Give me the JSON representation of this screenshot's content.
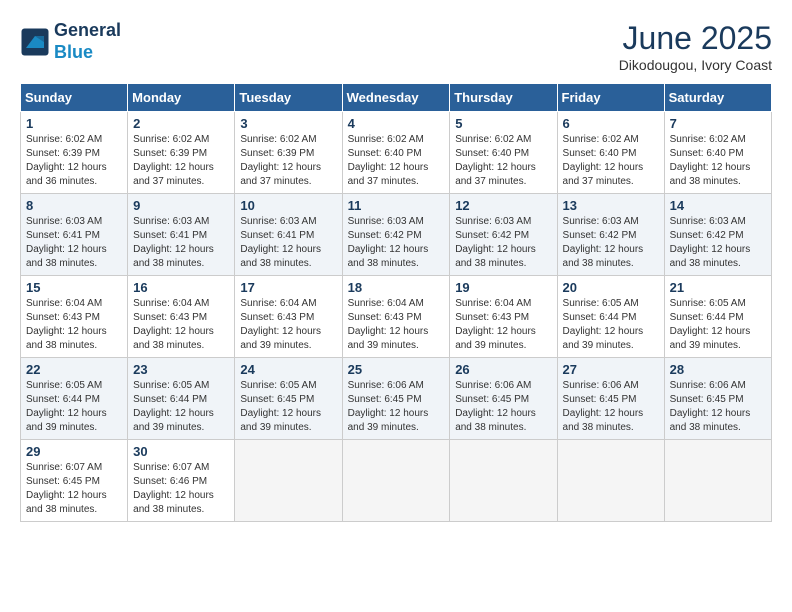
{
  "header": {
    "logo_line1": "General",
    "logo_line2": "Blue",
    "title": "June 2025",
    "location": "Dikodougou, Ivory Coast"
  },
  "calendar": {
    "days_of_week": [
      "Sunday",
      "Monday",
      "Tuesday",
      "Wednesday",
      "Thursday",
      "Friday",
      "Saturday"
    ],
    "weeks": [
      [
        {
          "day": "",
          "info": ""
        },
        {
          "day": "2",
          "info": "Sunrise: 6:02 AM\nSunset: 6:39 PM\nDaylight: 12 hours and 37 minutes."
        },
        {
          "day": "3",
          "info": "Sunrise: 6:02 AM\nSunset: 6:39 PM\nDaylight: 12 hours and 37 minutes."
        },
        {
          "day": "4",
          "info": "Sunrise: 6:02 AM\nSunset: 6:40 PM\nDaylight: 12 hours and 37 minutes."
        },
        {
          "day": "5",
          "info": "Sunrise: 6:02 AM\nSunset: 6:40 PM\nDaylight: 12 hours and 37 minutes."
        },
        {
          "day": "6",
          "info": "Sunrise: 6:02 AM\nSunset: 6:40 PM\nDaylight: 12 hours and 37 minutes."
        },
        {
          "day": "7",
          "info": "Sunrise: 6:02 AM\nSunset: 6:40 PM\nDaylight: 12 hours and 38 minutes."
        }
      ],
      [
        {
          "day": "1",
          "info": "Sunrise: 6:02 AM\nSunset: 6:39 PM\nDaylight: 12 hours and 36 minutes."
        },
        {
          "day": "9",
          "info": "Sunrise: 6:03 AM\nSunset: 6:41 PM\nDaylight: 12 hours and 38 minutes."
        },
        {
          "day": "10",
          "info": "Sunrise: 6:03 AM\nSunset: 6:41 PM\nDaylight: 12 hours and 38 minutes."
        },
        {
          "day": "11",
          "info": "Sunrise: 6:03 AM\nSunset: 6:42 PM\nDaylight: 12 hours and 38 minutes."
        },
        {
          "day": "12",
          "info": "Sunrise: 6:03 AM\nSunset: 6:42 PM\nDaylight: 12 hours and 38 minutes."
        },
        {
          "day": "13",
          "info": "Sunrise: 6:03 AM\nSunset: 6:42 PM\nDaylight: 12 hours and 38 minutes."
        },
        {
          "day": "14",
          "info": "Sunrise: 6:03 AM\nSunset: 6:42 PM\nDaylight: 12 hours and 38 minutes."
        }
      ],
      [
        {
          "day": "8",
          "info": "Sunrise: 6:03 AM\nSunset: 6:41 PM\nDaylight: 12 hours and 38 minutes."
        },
        {
          "day": "16",
          "info": "Sunrise: 6:04 AM\nSunset: 6:43 PM\nDaylight: 12 hours and 38 minutes."
        },
        {
          "day": "17",
          "info": "Sunrise: 6:04 AM\nSunset: 6:43 PM\nDaylight: 12 hours and 39 minutes."
        },
        {
          "day": "18",
          "info": "Sunrise: 6:04 AM\nSunset: 6:43 PM\nDaylight: 12 hours and 39 minutes."
        },
        {
          "day": "19",
          "info": "Sunrise: 6:04 AM\nSunset: 6:43 PM\nDaylight: 12 hours and 39 minutes."
        },
        {
          "day": "20",
          "info": "Sunrise: 6:05 AM\nSunset: 6:44 PM\nDaylight: 12 hours and 39 minutes."
        },
        {
          "day": "21",
          "info": "Sunrise: 6:05 AM\nSunset: 6:44 PM\nDaylight: 12 hours and 39 minutes."
        }
      ],
      [
        {
          "day": "15",
          "info": "Sunrise: 6:04 AM\nSunset: 6:43 PM\nDaylight: 12 hours and 38 minutes."
        },
        {
          "day": "23",
          "info": "Sunrise: 6:05 AM\nSunset: 6:44 PM\nDaylight: 12 hours and 39 minutes."
        },
        {
          "day": "24",
          "info": "Sunrise: 6:05 AM\nSunset: 6:45 PM\nDaylight: 12 hours and 39 minutes."
        },
        {
          "day": "25",
          "info": "Sunrise: 6:06 AM\nSunset: 6:45 PM\nDaylight: 12 hours and 39 minutes."
        },
        {
          "day": "26",
          "info": "Sunrise: 6:06 AM\nSunset: 6:45 PM\nDaylight: 12 hours and 38 minutes."
        },
        {
          "day": "27",
          "info": "Sunrise: 6:06 AM\nSunset: 6:45 PM\nDaylight: 12 hours and 38 minutes."
        },
        {
          "day": "28",
          "info": "Sunrise: 6:06 AM\nSunset: 6:45 PM\nDaylight: 12 hours and 38 minutes."
        }
      ],
      [
        {
          "day": "22",
          "info": "Sunrise: 6:05 AM\nSunset: 6:44 PM\nDaylight: 12 hours and 39 minutes."
        },
        {
          "day": "30",
          "info": "Sunrise: 6:07 AM\nSunset: 6:46 PM\nDaylight: 12 hours and 38 minutes."
        },
        {
          "day": "",
          "info": ""
        },
        {
          "day": "",
          "info": ""
        },
        {
          "day": "",
          "info": ""
        },
        {
          "day": "",
          "info": ""
        },
        {
          "day": "",
          "info": ""
        }
      ],
      [
        {
          "day": "29",
          "info": "Sunrise: 6:07 AM\nSunset: 6:45 PM\nDaylight: 12 hours and 38 minutes."
        },
        {
          "day": "",
          "info": ""
        },
        {
          "day": "",
          "info": ""
        },
        {
          "day": "",
          "info": ""
        },
        {
          "day": "",
          "info": ""
        },
        {
          "day": "",
          "info": ""
        },
        {
          "day": "",
          "info": ""
        }
      ]
    ]
  }
}
